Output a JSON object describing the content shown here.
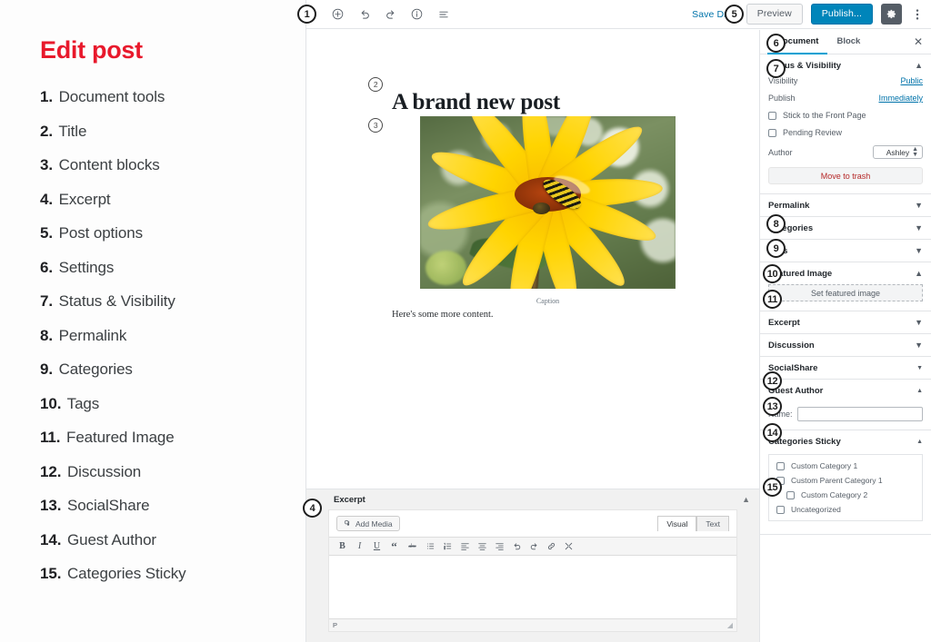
{
  "legend": {
    "title": "Edit post",
    "items": [
      {
        "num": "1.",
        "label": "Document tools"
      },
      {
        "num": "2.",
        "label": "Title"
      },
      {
        "num": "3.",
        "label": "Content blocks"
      },
      {
        "num": "4.",
        "label": "Excerpt"
      },
      {
        "num": "5.",
        "label": "Post options"
      },
      {
        "num": "6.",
        "label": "Settings"
      },
      {
        "num": "7.",
        "label": "Status & Visibility"
      },
      {
        "num": "8.",
        "label": "Permalink"
      },
      {
        "num": "9.",
        "label": "Categories"
      },
      {
        "num": "10.",
        "label": "Tags"
      },
      {
        "num": "11.",
        "label": "Featured Image"
      },
      {
        "num": "12.",
        "label": "Discussion"
      },
      {
        "num": "13.",
        "label": "SocialShare"
      },
      {
        "num": "14.",
        "label": "Guest Author"
      },
      {
        "num": "15.",
        "label": "Categories Sticky"
      }
    ]
  },
  "badges": {
    "b1": "1",
    "b2": "2",
    "b3": "3",
    "b4": "4",
    "b5": "5",
    "b6": "6",
    "b7": "7",
    "b8": "8",
    "b9": "9",
    "b10": "10",
    "b11": "11",
    "b12": "12",
    "b13": "13",
    "b14": "14",
    "b15": "15"
  },
  "topbar": {
    "save_draft": "Save Draft",
    "preview": "Preview",
    "publish": "Publish...",
    "icons": [
      "add-block-icon",
      "undo-icon",
      "redo-icon",
      "info-icon",
      "list-view-icon"
    ]
  },
  "canvas": {
    "title": "A brand new post",
    "caption": "Caption",
    "body": "Here's some more content."
  },
  "sidebar": {
    "tabs": [
      {
        "label": "Document",
        "active": true
      },
      {
        "label": "Block",
        "active": false
      }
    ],
    "status": {
      "title": "Status & Visibility",
      "visibility_label": "Visibility",
      "visibility_value": "Public",
      "publish_label": "Publish",
      "publish_value": "Immediately",
      "sticky_label": "Stick to the Front Page",
      "pending_label": "Pending Review",
      "author_label": "Author",
      "author_value": "Ashley",
      "trash_label": "Move to trash"
    },
    "permalink": "Permalink",
    "categories": "Categories",
    "tags": "Tags",
    "featured": {
      "title": "Featured Image",
      "button": "Set featured image"
    },
    "excerpt": "Excerpt",
    "discussion": "Discussion",
    "socialshare": "SocialShare",
    "guest_author": {
      "title": "Guest Author",
      "name_label": "Name:",
      "name_value": ""
    },
    "cat_sticky": {
      "title": "Categories Sticky",
      "options": [
        {
          "label": "Custom Category 1",
          "indent": false
        },
        {
          "label": "Custom Parent Category 1",
          "indent": false
        },
        {
          "label": "Custom Category 2",
          "indent": true
        },
        {
          "label": "Uncategorized",
          "indent": false
        }
      ]
    }
  },
  "excerpt_panel": {
    "title": "Excerpt",
    "add_media": "Add Media",
    "visual_tab": "Visual",
    "text_tab": "Text",
    "content": "",
    "status_path": "P",
    "format_buttons": [
      {
        "name": "bold-icon",
        "glyph": "B"
      },
      {
        "name": "italic-icon",
        "glyph": "I"
      },
      {
        "name": "underline-icon",
        "glyph": "U"
      },
      {
        "name": "blockquote-icon",
        "glyph": "“"
      },
      {
        "name": "strikethrough-icon",
        "glyph": "abc"
      },
      {
        "name": "bullet-list-icon",
        "glyph": "≡"
      },
      {
        "name": "numbered-list-icon",
        "glyph": "≡"
      },
      {
        "name": "align-left-icon",
        "glyph": "≡"
      },
      {
        "name": "align-center-icon",
        "glyph": "≡"
      },
      {
        "name": "align-right-icon",
        "glyph": "≡"
      },
      {
        "name": "undo-icon",
        "glyph": "↶"
      },
      {
        "name": "redo-icon",
        "glyph": "↷"
      },
      {
        "name": "link-icon",
        "glyph": "🔗"
      },
      {
        "name": "fullscreen-icon",
        "glyph": "✕"
      }
    ]
  },
  "colors": {
    "accent_red": "#e8192c",
    "publish_blue": "#0085ba",
    "link_blue": "#0073aa",
    "trash_red": "#b52727"
  }
}
